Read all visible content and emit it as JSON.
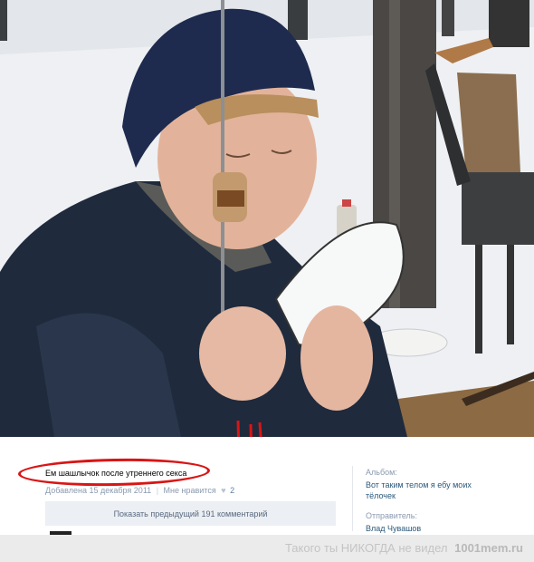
{
  "post": {
    "caption": "Ем шашлычок после утреннего секса",
    "added": "Добавлена 15 декабря 2011",
    "like_label": "Мне нравится",
    "likes_count": "2",
    "show_previous": "Показать предыдущий 191 комментарий"
  },
  "sidebar": {
    "album_label": "Альбом:",
    "album_value": "Вот таким телом я ебу моих тёлочек",
    "sender_label": "Отправитель:",
    "sender_value": "Влад Чувашов"
  },
  "watermark": {
    "text": "Такого ты НИКОГДА не видел",
    "site": "1001mem.ru"
  },
  "colors": {
    "annotation_red": "#d91515",
    "link_blue": "#2b587a",
    "meta_gray": "#8a9ab0"
  },
  "icons": [
    "heart-icon"
  ]
}
